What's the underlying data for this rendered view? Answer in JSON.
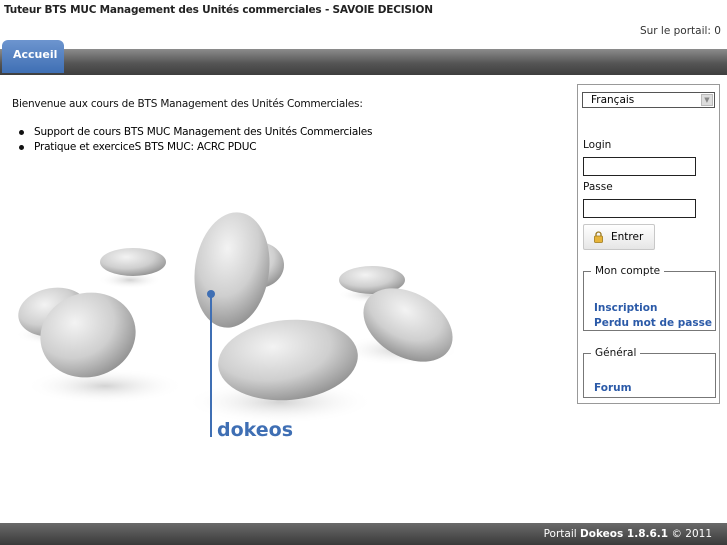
{
  "header": {
    "title": "Tuteur BTS MUC Management des Unités commerciales - SAVOIE DECISION",
    "online_label": "Sur le portail: 0"
  },
  "nav": {
    "tabs": [
      {
        "label": "Accueil",
        "active": true
      }
    ]
  },
  "main": {
    "welcome": "Bienvenue aux cours de BTS Management des Unités Commerciales:",
    "links": [
      "Support de cours BTS MUC Management des Unités Commerciales",
      "Pratique et exerciceS BTS MUC: ACRC PDUC"
    ],
    "logo_text": "dokeos"
  },
  "sidebar": {
    "language": {
      "selected": "Français"
    },
    "login_label": "Login",
    "password_label": "Passe",
    "submit_label": "Entrer",
    "account": {
      "legend": "Mon compte",
      "links": [
        "Inscription",
        "Perdu mot de passe"
      ]
    },
    "general": {
      "legend": "Général",
      "links": [
        "Forum"
      ]
    }
  },
  "footer": {
    "prefix": "Portail",
    "brand": "Dokeos 1.8.6.1",
    "suffix": "© 2011"
  },
  "colors": {
    "accent": "#3f6fb4",
    "link": "#2b5aa8",
    "navbar": "#4a4a4a"
  },
  "icons": [
    "lock-icon",
    "chevron-down-icon"
  ]
}
